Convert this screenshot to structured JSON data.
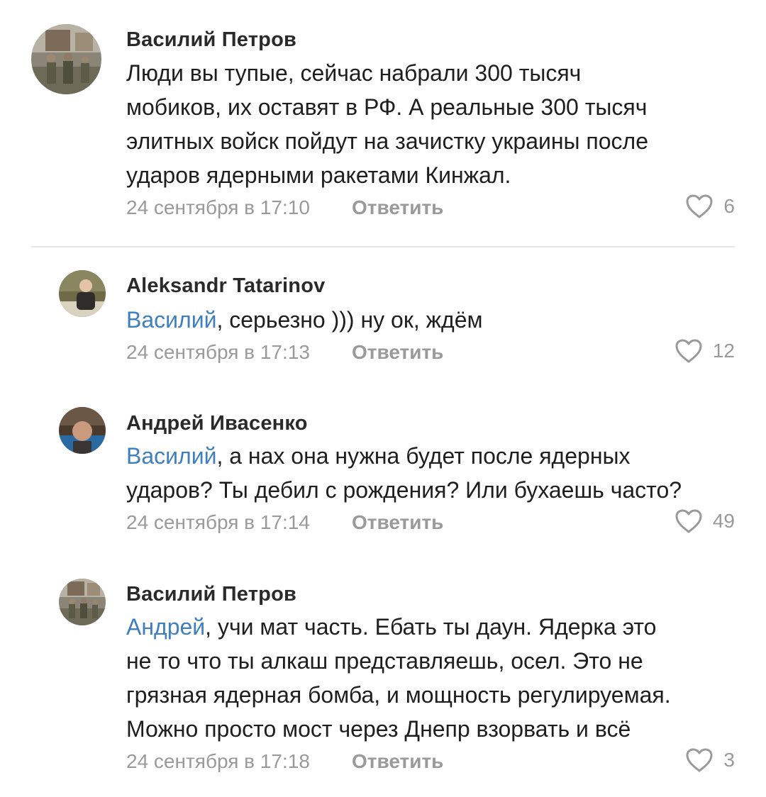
{
  "comments": [
    {
      "author": "Василий Петров",
      "lines": [
        "Люди вы тупые, сейчас набрали 300 тысяч",
        "мобиков, их оставят в РФ. А реальные 300 тысяч",
        "элитных войск пойдут на зачистку украины после",
        "ударов ядерными ракетами Кинжал."
      ],
      "date": "24 сентября в 17:10",
      "reply_label": "Ответить",
      "likes": "6"
    },
    {
      "author": "Aleksandr Tatarinov",
      "mention": "Василий",
      "lines": [
        ", серьезно ))) ну ок, ждём"
      ],
      "date": "24 сентября в 17:13",
      "reply_label": "Ответить",
      "likes": "12"
    },
    {
      "author": "Андрей Ивасенко",
      "mention": "Василий",
      "lines": [
        ", а нах она нужна будет после ядерных",
        "ударов? Ты дебил с рождения? Или бухаешь часто?"
      ],
      "date": "24 сентября в 17:14",
      "reply_label": "Ответить",
      "likes": "49"
    },
    {
      "author": "Василий Петров",
      "mention": "Андрей",
      "lines": [
        ", учи мат часть. Ебать ты даун. Ядерка это",
        "не то что ты алкаш представляешь, осел. Это не",
        "грязная ядерная бомба, и мощность регулируемая.",
        "Можно просто мост через Днепр взорвать и всё"
      ],
      "date": "24 сентября в 17:18",
      "reply_label": "Ответить",
      "likes": "3"
    }
  ],
  "colors": {
    "mention": "#3f7fbf",
    "meta": "#9a9a9a",
    "author": "#2a2a2a",
    "divider": "#e6e6e6"
  }
}
